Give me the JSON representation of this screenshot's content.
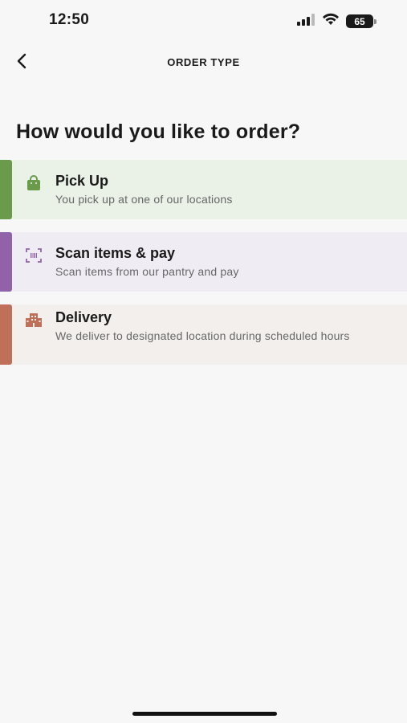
{
  "status_bar": {
    "time": "12:50",
    "battery_level": "65",
    "battery_percent": 65,
    "icons": [
      "signal-icon",
      "wifi-icon",
      "battery-icon"
    ]
  },
  "header": {
    "back_icon": "chevron-left-icon",
    "title": "ORDER TYPE"
  },
  "main": {
    "heading": "How would you like to order?",
    "options": [
      {
        "title": "Pick Up",
        "description": "You pick up at one of our locations",
        "icon": "shopping-bag-icon",
        "accent_color": "#6a9b4a",
        "background_color": "#eaf2e8"
      },
      {
        "title": "Scan items & pay",
        "description": "Scan items from our pantry and pay",
        "icon": "barcode-scan-icon",
        "accent_color": "#9063a8",
        "background_color": "#efedf3"
      },
      {
        "title": "Delivery",
        "description": "We deliver to designated location during scheduled hours",
        "icon": "building-icon",
        "accent_color": "#c07058",
        "background_color": "#f3efed"
      }
    ]
  }
}
